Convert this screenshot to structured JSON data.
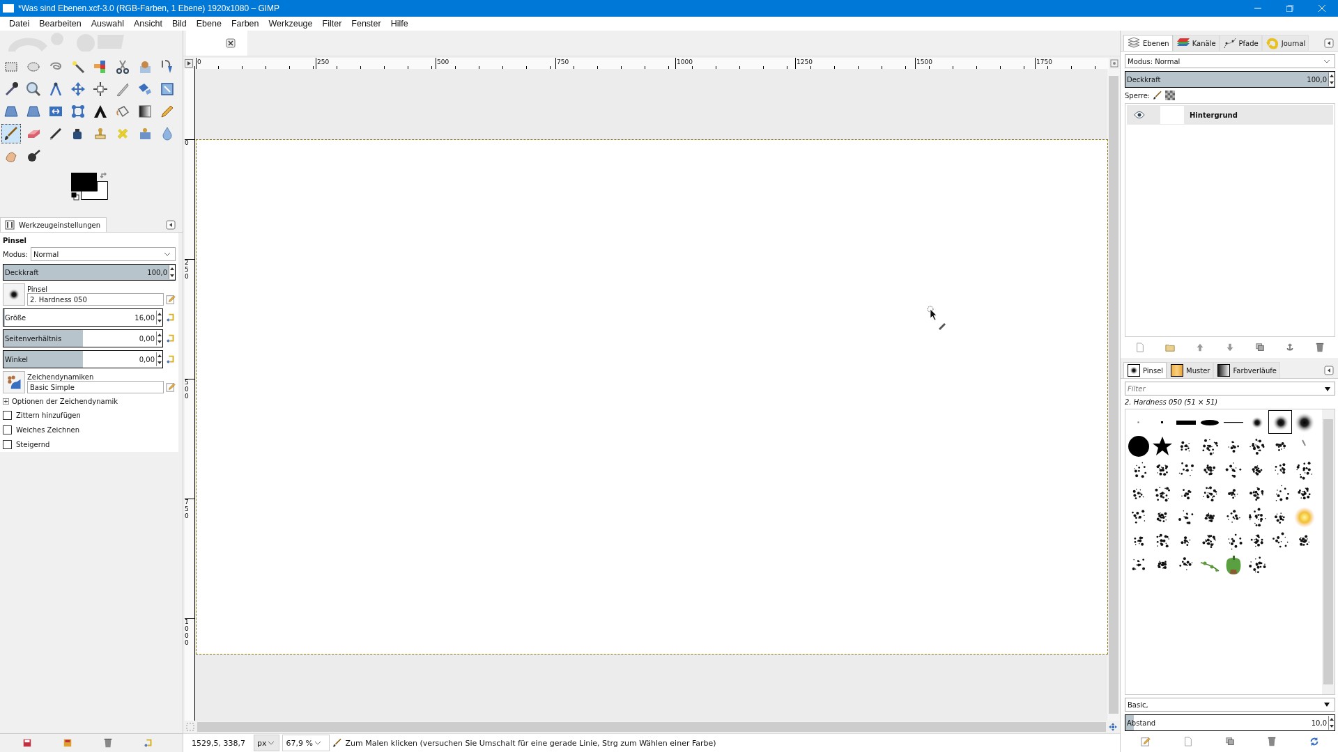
{
  "window": {
    "title": "*Was sind Ebenen.xcf-3.0 (RGB-Farben, 1 Ebene) 1920x1080 – GIMP"
  },
  "menu": [
    "Datei",
    "Bearbeiten",
    "Auswahl",
    "Ansicht",
    "Bild",
    "Ebene",
    "Farben",
    "Werkzeuge",
    "Filter",
    "Fenster",
    "Hilfe"
  ],
  "toolbox": {
    "tools": [
      {
        "selected": false
      },
      {
        "selected": false
      },
      {
        "selected": false
      },
      {
        "selected": false
      },
      {
        "selected": false
      },
      {
        "selected": false
      },
      {
        "selected": false
      },
      {
        "selected": false
      },
      {
        "selected": false
      },
      {
        "selected": false
      },
      {
        "selected": false
      },
      {
        "selected": false
      },
      {
        "selected": false
      },
      {
        "selected": false
      },
      {
        "selected": false
      },
      {
        "selected": false
      },
      {
        "selected": false
      },
      {
        "selected": false
      },
      {
        "selected": false
      },
      {
        "selected": false
      },
      {
        "selected": false
      },
      {
        "selected": false
      },
      {
        "selected": false
      },
      {
        "selected": false
      },
      {
        "selected": true
      },
      {
        "selected": false
      },
      {
        "selected": false
      },
      {
        "selected": false
      },
      {
        "selected": false
      },
      {
        "selected": false
      },
      {
        "selected": false
      },
      {
        "selected": false
      },
      {
        "selected": false
      },
      {
        "selected": false
      }
    ]
  },
  "tool_options": {
    "tab": "Werkzeugeinstellungen",
    "tool": "Pinsel",
    "mode_label": "Modus:",
    "mode": "Normal",
    "opacity": {
      "label": "Deckkraft",
      "value": "100,0",
      "level": 1
    },
    "brush": {
      "label": "Pinsel",
      "value": "2. Hardness 050"
    },
    "sliders": [
      {
        "label": "Größe",
        "value": "16,00",
        "level": 0.01
      },
      {
        "label": "Seitenverhältnis",
        "value": "0,00",
        "level": 0.5
      },
      {
        "label": "Winkel",
        "value": "0,00",
        "level": 0.5
      }
    ],
    "dynamics": {
      "label": "Zeichendynamiken",
      "value": "Basic Simple"
    },
    "expander": {
      "label": "Optionen der Zeichendynamik",
      "expanded": false
    },
    "checkboxes": [
      {
        "label": "Zittern hinzufügen",
        "checked": false
      },
      {
        "label": "Weiches Zeichnen",
        "checked": false
      },
      {
        "label": "Steigernd",
        "checked": false
      }
    ]
  },
  "canvas": {
    "ruler_labels": [
      "0",
      "250",
      "500",
      "750",
      "1000",
      "1250",
      "1500",
      "1750"
    ],
    "vruler_labels": [
      "0",
      "250",
      "500",
      "750",
      "1000"
    ]
  },
  "status_bar": {
    "coords": "1529,5, 338,7",
    "unit": "px",
    "zoom": "67,9 %",
    "message": "Zum Malen klicken (versuchen Sie Umschalt für eine gerade Linie, Strg zum Wählen einer Farbe)"
  },
  "layers_dock": {
    "tabs": [
      {
        "label": "Ebenen",
        "selected": true
      },
      {
        "label": "Kanäle",
        "selected": false
      },
      {
        "label": "Pfade",
        "selected": false
      },
      {
        "label": "Journal",
        "selected": false
      }
    ],
    "mode_label": "Modus:",
    "mode": "Normal",
    "opacity": {
      "label": "Deckkraft",
      "value": "100,0",
      "level": 1
    },
    "lock_label": "Sperre:",
    "layers": [
      {
        "name": "Hintergrund",
        "visible": true,
        "selected": true
      }
    ]
  },
  "brushes_dock": {
    "tabs": [
      {
        "label": "Pinsel",
        "selected": true
      },
      {
        "label": "Muster",
        "selected": false
      },
      {
        "label": "Farbverläufe",
        "selected": false
      }
    ],
    "filter_placeholder": "Filter",
    "current": "2. Hardness 050 (51 × 51)",
    "brushes": [
      {
        "selected": false
      },
      {
        "selected": false
      },
      {
        "selected": false
      },
      {
        "selected": false
      },
      {
        "selected": false
      },
      {
        "selected": false
      },
      {
        "selected": true
      },
      {
        "selected": false
      },
      {
        "selected": false
      },
      {
        "selected": false
      },
      {
        "selected": false
      },
      {
        "selected": false
      },
      {
        "selected": false
      },
      {
        "selected": false
      },
      {
        "selected": false
      },
      {
        "selected": false
      },
      {
        "selected": false
      },
      {
        "selected": false
      },
      {
        "selected": false
      },
      {
        "selected": false
      },
      {
        "selected": false
      },
      {
        "selected": false
      },
      {
        "selected": false
      },
      {
        "selected": false
      },
      {
        "selected": false
      },
      {
        "selected": false
      },
      {
        "selected": false
      },
      {
        "selected": false
      },
      {
        "selected": false
      },
      {
        "selected": false
      },
      {
        "selected": false
      },
      {
        "selected": false
      },
      {
        "selected": false
      },
      {
        "selected": false
      },
      {
        "selected": false
      },
      {
        "selected": false
      },
      {
        "selected": false
      },
      {
        "selected": false
      },
      {
        "selected": false
      },
      {
        "selected": false
      },
      {
        "selected": false
      },
      {
        "selected": false
      },
      {
        "selected": false
      },
      {
        "selected": false
      },
      {
        "selected": false
      },
      {
        "selected": false
      },
      {
        "selected": false
      },
      {
        "selected": false
      },
      {
        "selected": false
      },
      {
        "selected": false
      },
      {
        "selected": false
      },
      {
        "selected": false
      },
      {
        "selected": false
      },
      {
        "selected": false
      }
    ],
    "tag": "Basic,",
    "spacing": {
      "label": "Abstand",
      "value": "10,0",
      "level": 0.04
    }
  }
}
